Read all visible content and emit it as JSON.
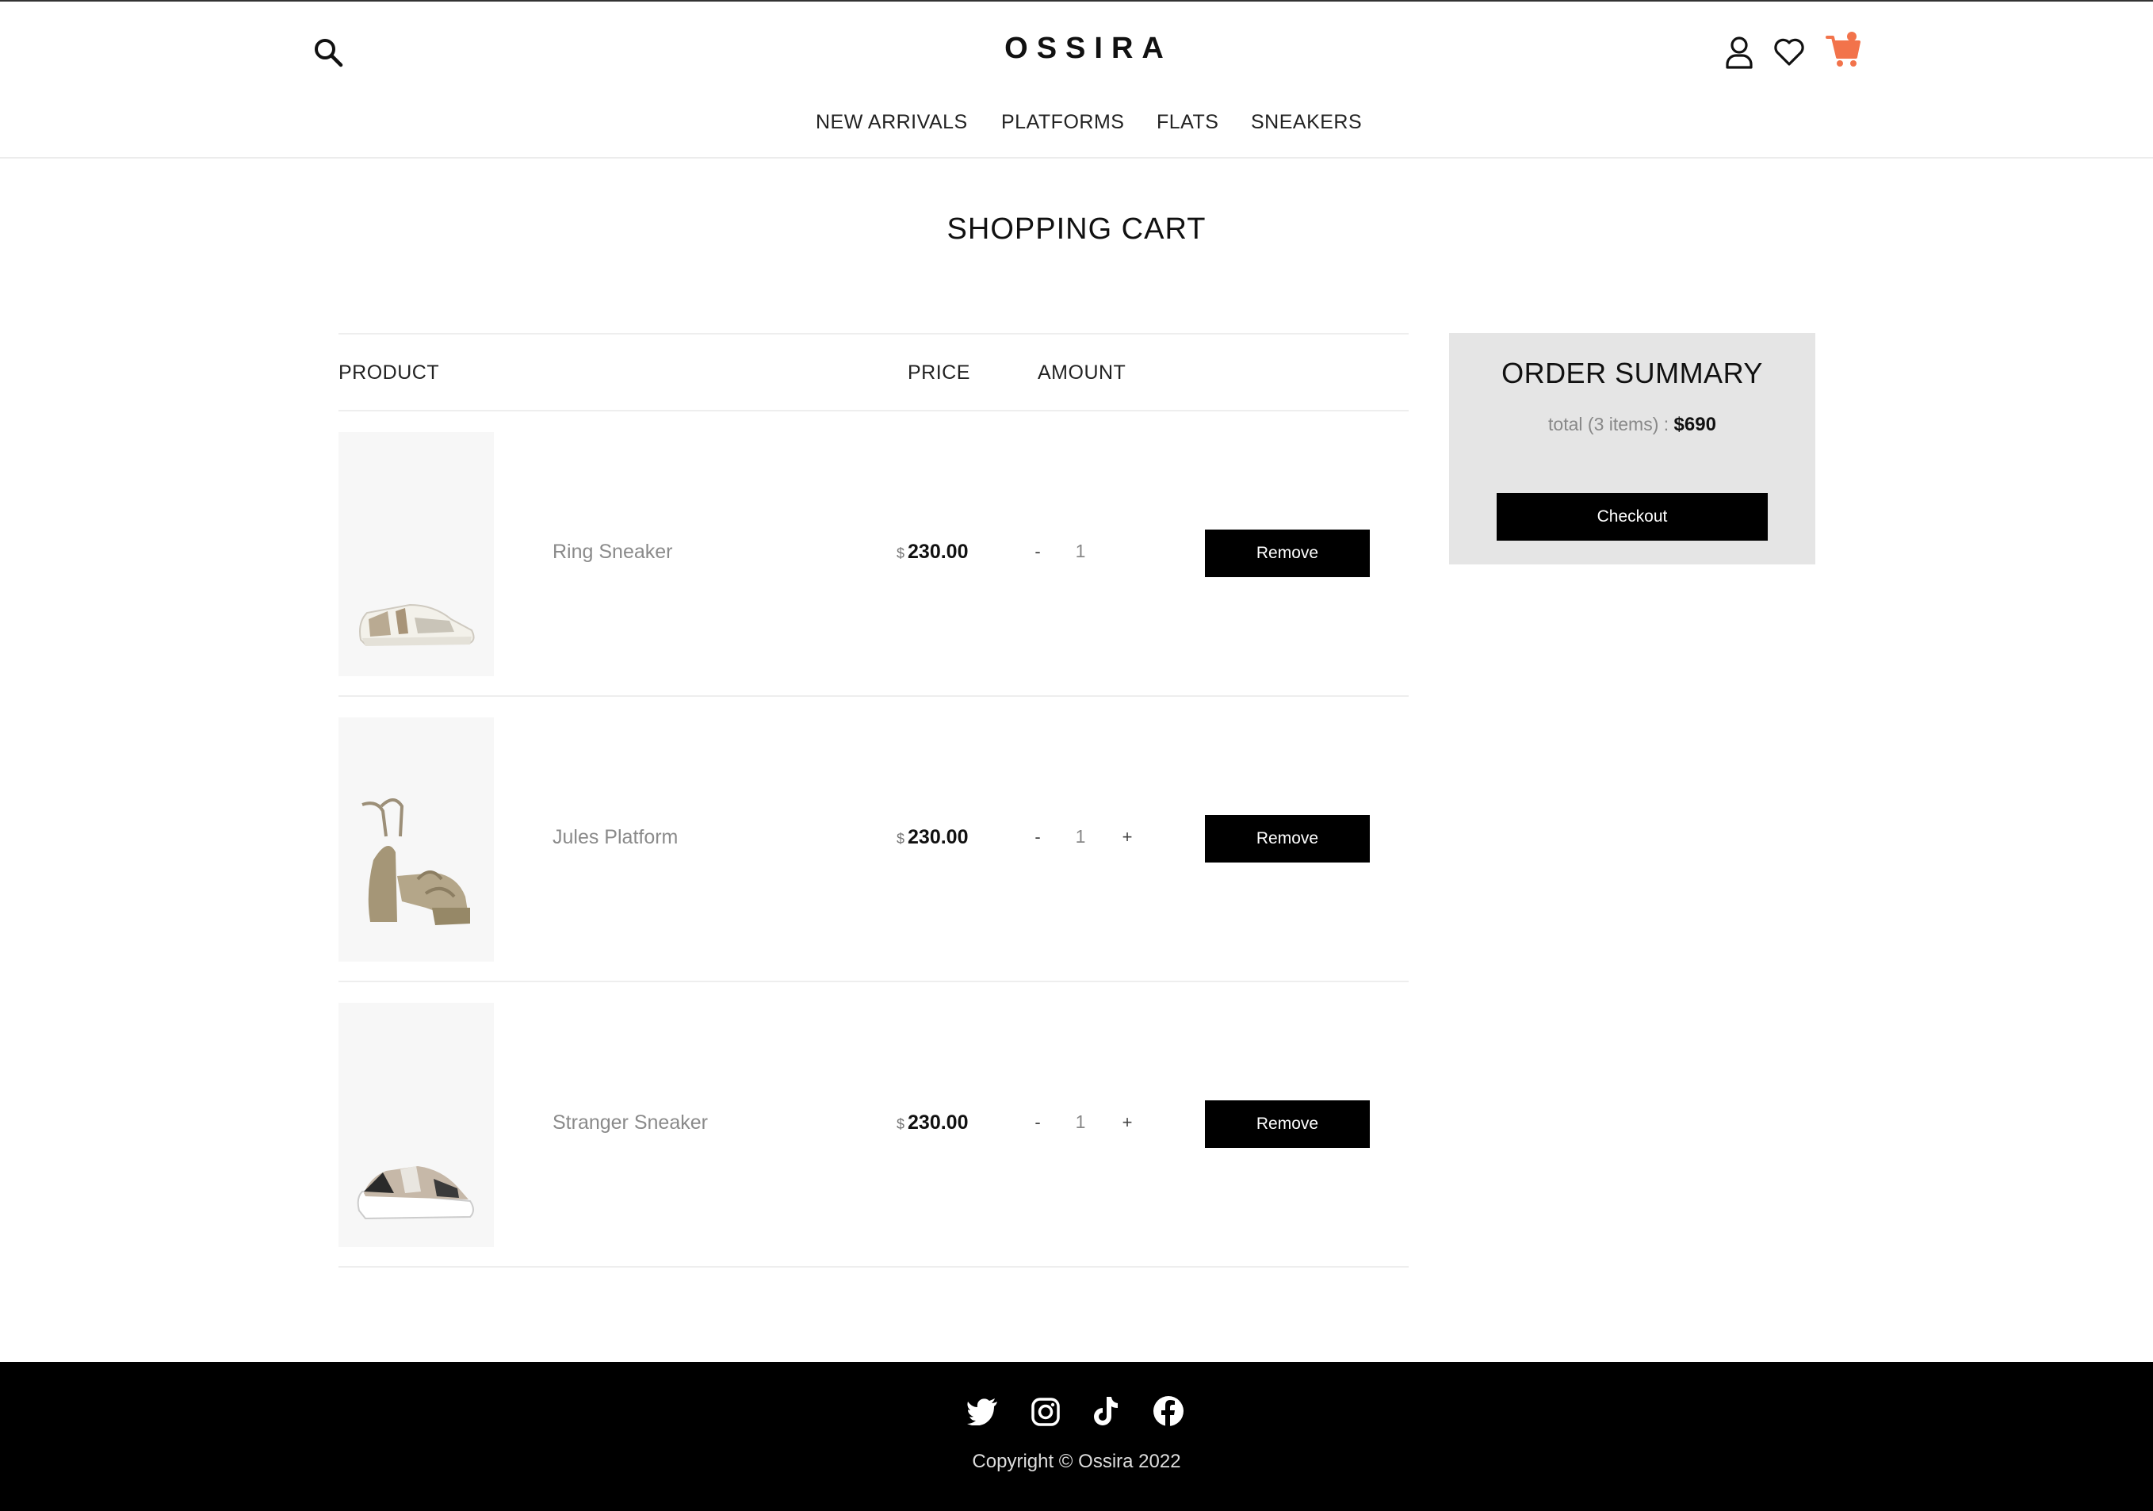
{
  "brand": {
    "name": "OSSIRA",
    "accent": "#f2734b"
  },
  "header": {
    "search_icon": "search-icon",
    "account_icon": "user-icon",
    "wishlist_icon": "heart-icon",
    "cart_icon": "shopping-cart-icon"
  },
  "nav": [
    {
      "label": "NEW ARRIVALS"
    },
    {
      "label": "PLATFORMS"
    },
    {
      "label": "FLATS"
    },
    {
      "label": "SNEAKERS"
    }
  ],
  "cart": {
    "title": "SHOPPING CART",
    "columns": {
      "product": "PRODUCT",
      "price": "PRICE",
      "amount": "AMOUNT"
    },
    "items": [
      {
        "name": "Ring Sneaker",
        "currency": "$",
        "price": "230.00",
        "qty_minus": "-",
        "quantity": "1",
        "qty_plus": "+",
        "remove_label": "Remove"
      },
      {
        "name": "Jules Platform",
        "currency": "$",
        "price": "230.00",
        "qty_minus": "-",
        "quantity": "1",
        "qty_plus": "+",
        "remove_label": "Remove"
      },
      {
        "name": "Stranger Sneaker",
        "currency": "$",
        "price": "230.00",
        "qty_minus": "-",
        "quantity": "1",
        "qty_plus": "+",
        "remove_label": "Remove"
      }
    ]
  },
  "summary": {
    "title": "ORDER SUMMARY",
    "total_label": "total (3 items) :",
    "total_value": "$690",
    "checkout_label": "Checkout"
  },
  "footer": {
    "social_icons": [
      "twitter-icon",
      "instagram-icon",
      "tiktok-icon",
      "facebook-icon"
    ],
    "copyright": "Copyright © Ossira 2022"
  }
}
